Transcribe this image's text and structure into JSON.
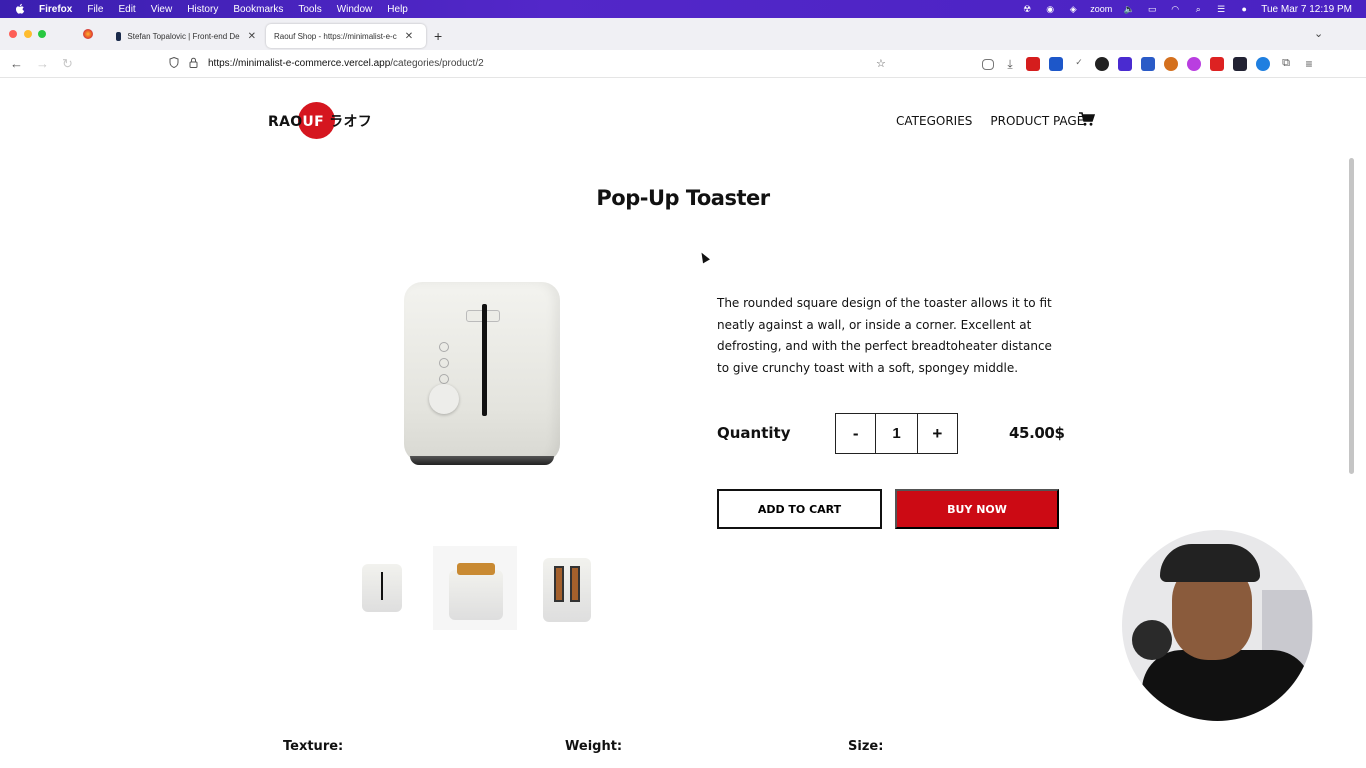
{
  "menubar": {
    "app": "Firefox",
    "items": [
      "File",
      "Edit",
      "View",
      "History",
      "Bookmarks",
      "Tools",
      "Window",
      "Help"
    ],
    "zoom_label": "zoom",
    "clock": "Tue Mar 7  12:19 PM"
  },
  "browser": {
    "tabs": [
      {
        "title": "Stefan Topalovic | Front-end De"
      },
      {
        "title": "Raouf Shop - https://minimalist-e-c"
      }
    ],
    "url_host": "https://minimalist-e-commerce.vercel.app",
    "url_path": "/categories/product/2"
  },
  "site": {
    "logo_black": "RAO",
    "logo_white": "UF",
    "logo_jp": " ラオフ",
    "nav": [
      "CATEGORIES",
      "PRODUCT PAGE"
    ]
  },
  "product": {
    "title": "Pop-Up Toaster",
    "description": "The rounded square design of the toaster allows it to fit neatly against a wall, or inside a corner. Excellent at defrosting, and with the perfect breadtoheater distance to give crunchy toast with a soft, spongey middle.",
    "quantity_label": "Quantity",
    "quantity_value": "1",
    "minus": "-",
    "plus": "+",
    "price": "45.00$",
    "add_to_cart": "ADD TO CART",
    "buy_now": "BUY NOW",
    "specs": [
      "Texture:",
      "Weight:",
      "Size:"
    ]
  },
  "colors": {
    "accent_red": "#cc0a14",
    "menubar_purple": "#4a22c2"
  }
}
